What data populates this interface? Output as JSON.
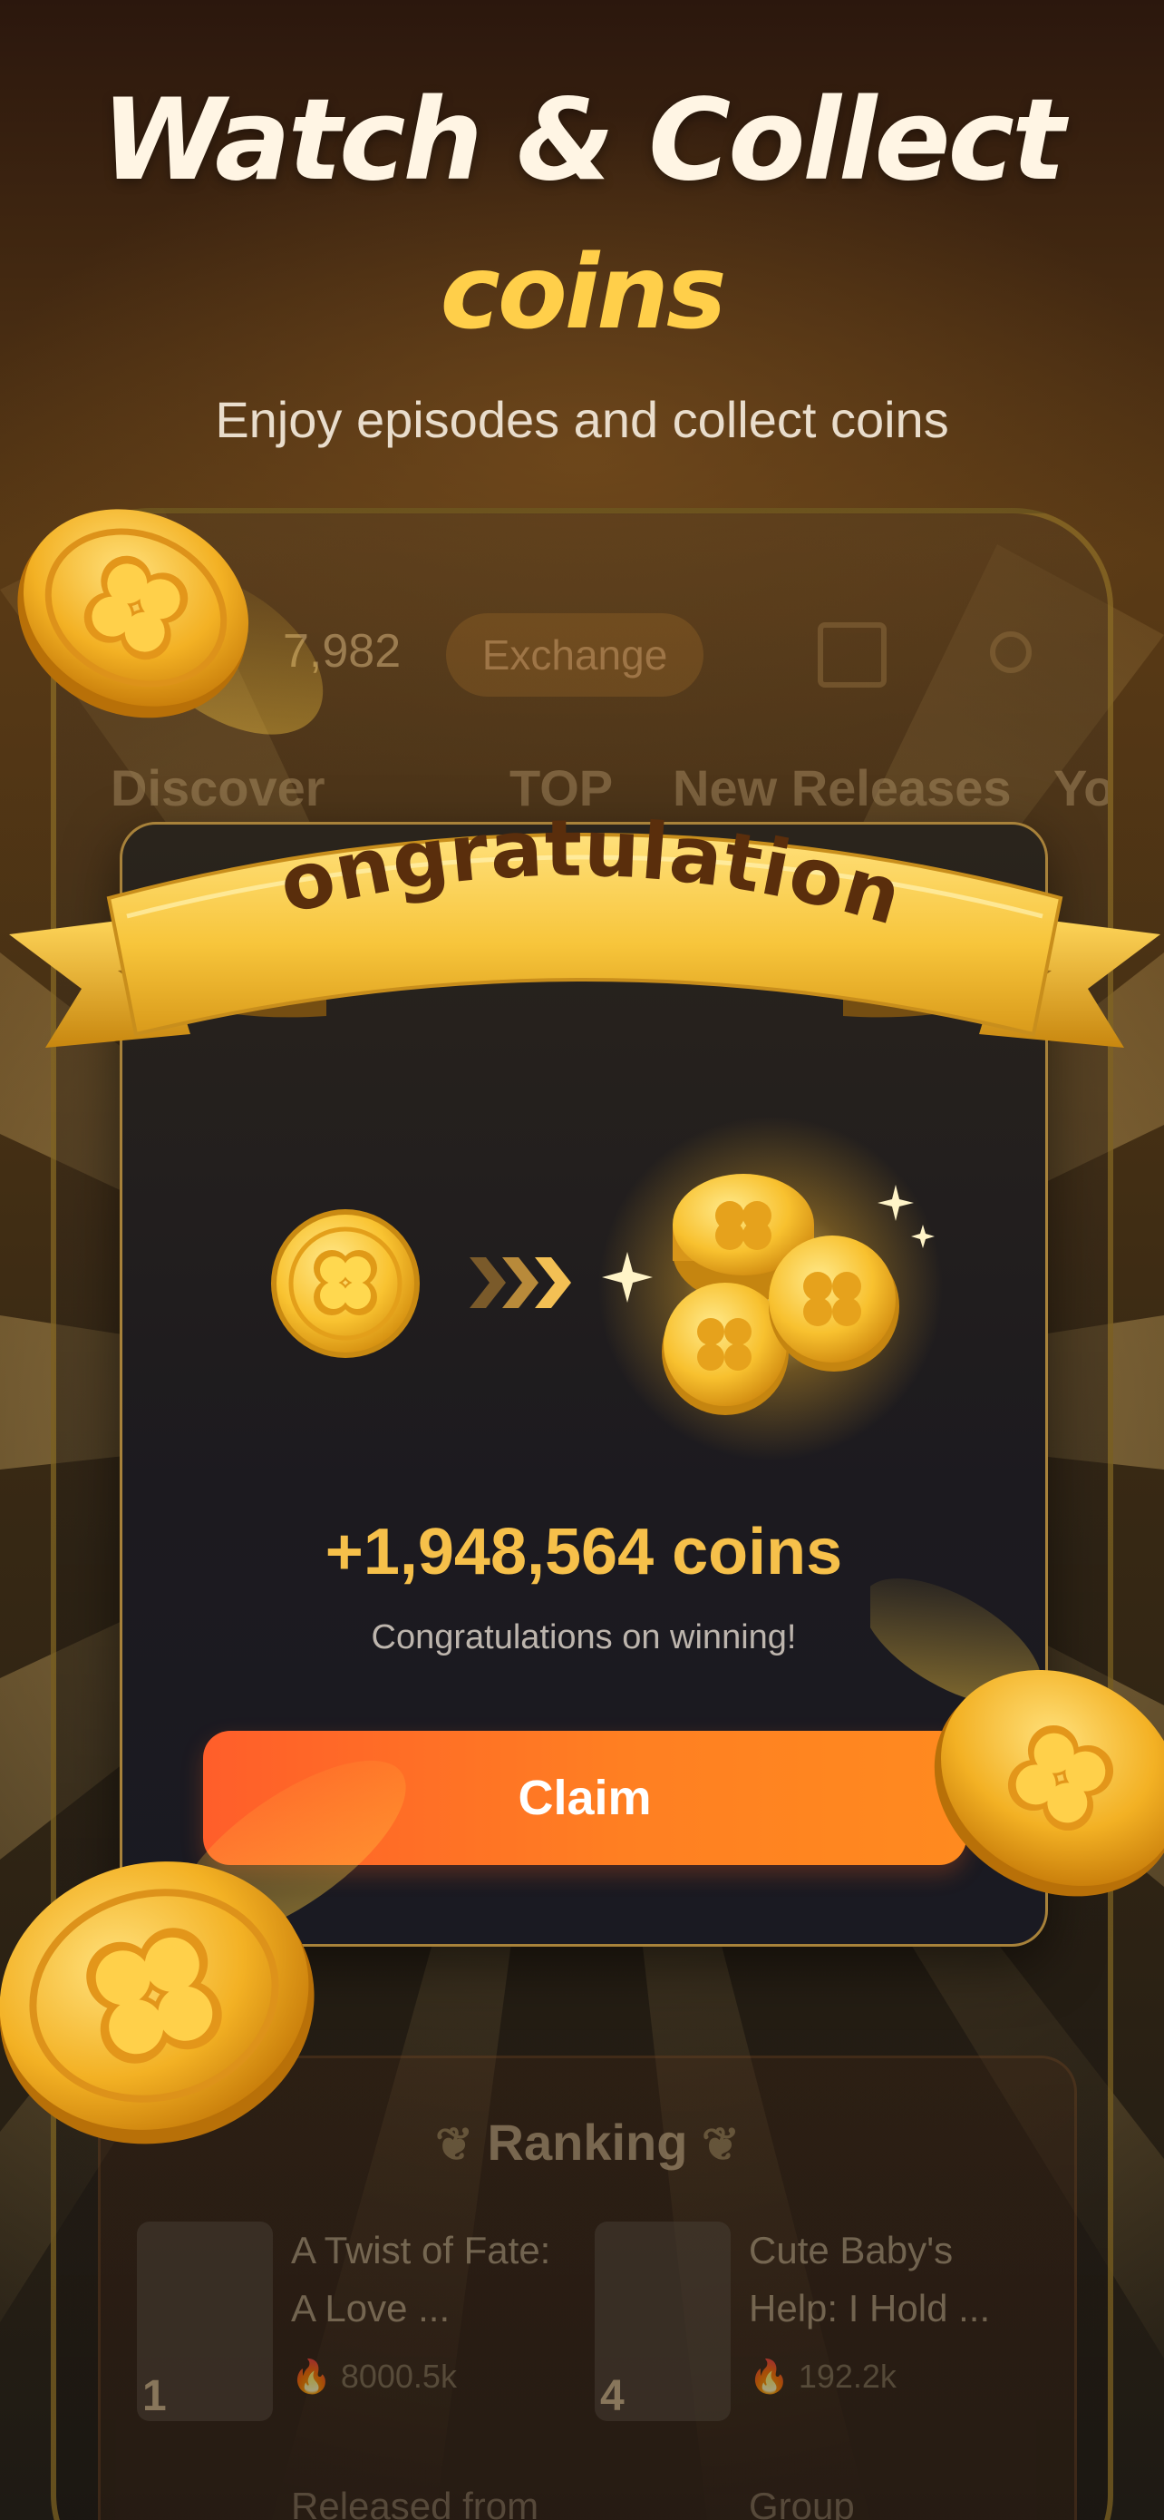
{
  "hero": {
    "title_line1": "Watch & Collect",
    "title_line2": "coins",
    "subtitle": "Enjoy episodes and collect coins"
  },
  "background_app": {
    "balance": "7,982",
    "exchange_label": "Exchange",
    "tabs": [
      "Discover",
      "TOP",
      "New Releases",
      "You"
    ],
    "ranking": {
      "title": "Ranking",
      "items": [
        {
          "rank": "1",
          "title": "A Twist of Fate: A Love ...",
          "views": "8000.5k"
        },
        {
          "rank": "4",
          "title": "Cute Baby's Help: I Hold ...",
          "views": "192.2k"
        }
      ],
      "bottom_left": "Released from",
      "bottom_right": "Group"
    }
  },
  "modal": {
    "banner_title": "Congratulations",
    "amount": "+1,948,564 coins",
    "message": "Congratulations on winning!",
    "claim_label": "Claim"
  },
  "colors": {
    "accent_gold": "#f6c04a",
    "claim_start": "#ff5e2a",
    "claim_end": "#ff8a1f",
    "banner_text": "#5a2e0c"
  },
  "icons": [
    "clover-coin-icon",
    "chevron-arrows-icon",
    "coin-pile-icon",
    "calendar-icon",
    "search-icon",
    "laurel-icon",
    "flame-icon"
  ]
}
